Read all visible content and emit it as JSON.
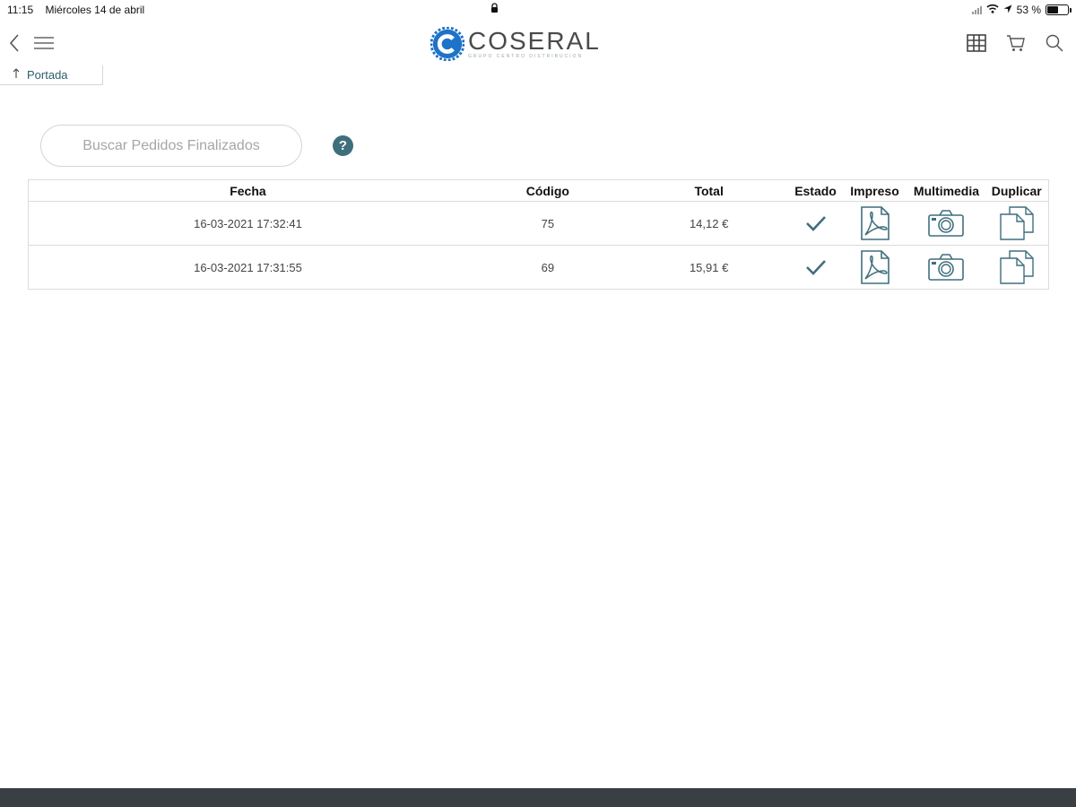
{
  "status_bar": {
    "time": "11:15",
    "date": "Miércoles 14 de abril",
    "battery": "53 %",
    "battery_level": 0.53,
    "icons": [
      "lock-icon",
      "signal-icon",
      "wifi-icon",
      "location-icon",
      "battery-icon"
    ]
  },
  "nav": {
    "logo_text": "COSERAL",
    "logo_subtext": "GRUPO CENTRO DISTRIBUCION",
    "left_icons": [
      "back-icon",
      "menu-icon"
    ],
    "right_icons": [
      "grid-icon",
      "cart-icon",
      "search-icon"
    ]
  },
  "breadcrumb": {
    "label": "Portada"
  },
  "search": {
    "placeholder": "Buscar Pedidos Finalizados"
  },
  "help": {
    "label": "?"
  },
  "table": {
    "headers": [
      "Fecha",
      "Código",
      "Total",
      "Estado",
      "Impreso",
      "Multimedia",
      "Duplicar"
    ],
    "rows": [
      {
        "fecha": "16-03-2021 17:32:41",
        "codigo": "75",
        "total": "14,12 €"
      },
      {
        "fecha": "16-03-2021 17:31:55",
        "codigo": "69",
        "total": "15,91 €"
      }
    ]
  },
  "colors": {
    "accent": "#3f6f7d",
    "brand_blue": "#1e73c8",
    "bottom_bar": "#3a3f44"
  }
}
